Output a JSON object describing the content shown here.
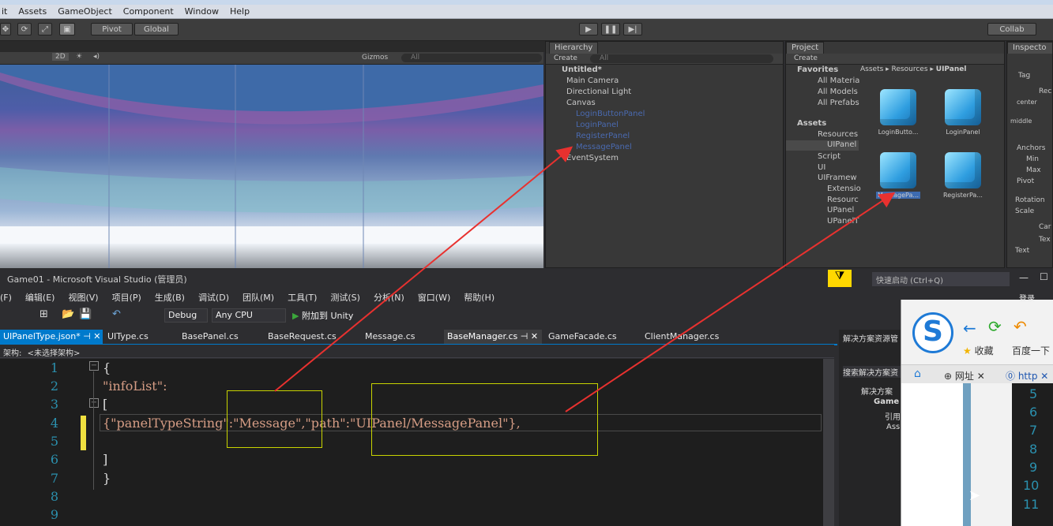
{
  "unity": {
    "menu": [
      "it",
      "Assets",
      "GameObject",
      "Component",
      "Window",
      "Help"
    ],
    "toolbar": {
      "pivot": "Pivot",
      "global": "Global",
      "collab": "Collab"
    },
    "scene": {
      "mode_2d": "2D",
      "gizmos": "Gizmos",
      "search_placeholder": "All"
    },
    "hierarchy": {
      "tab": "Hierarchy",
      "create": "Create",
      "search_placeholder": "All",
      "scene_name": "Untitled*",
      "items": [
        "Main Camera",
        "Directional Light",
        "Canvas",
        "LoginButtonPanel",
        "LoginPanel",
        "RegisterPanel",
        "MessagePanel",
        "EventSystem"
      ]
    },
    "project": {
      "tab": "Project",
      "create": "Create",
      "breadcrumb": [
        "Assets",
        "Resources",
        "UIPanel"
      ],
      "favorites_label": "Favorites",
      "favorites": [
        "All Materia",
        "All Models",
        "All Prefabs"
      ],
      "assets_label": "Assets",
      "tree": [
        "Resources",
        "UIPanel",
        "Script",
        "UI",
        "UIFramew",
        "Extensio",
        "Resourc",
        "UPanel",
        "UPanelT"
      ],
      "assets": [
        "LoginButto...",
        "LoginPanel",
        "MessagePa...",
        "RegisterPa..."
      ]
    },
    "inspector": {
      "tab": "Inspecto",
      "labels": [
        "Tag",
        "Rec",
        "center",
        "middle",
        "Anchors",
        "Min",
        "Max",
        "Pivot",
        "Rotation",
        "Scale",
        "Car",
        "Tex",
        "Text"
      ]
    }
  },
  "vs": {
    "title": "Game01 - Microsoft Visual Studio (管理员)",
    "quick_launch": "快速启动 (Ctrl+Q)",
    "login": "登录",
    "menu": [
      "(F)",
      "编辑(E)",
      "视图(V)",
      "项目(P)",
      "生成(B)",
      "调试(D)",
      "团队(M)",
      "工具(T)",
      "测试(S)",
      "分析(N)",
      "窗口(W)",
      "帮助(H)"
    ],
    "toolbar": {
      "config": "Debug",
      "platform": "Any CPU",
      "attach": "附加到 Unity"
    },
    "tabs": [
      "UIPanelType.json*",
      "UIType.cs",
      "BasePanel.cs",
      "BaseRequest.cs",
      "Message.cs",
      "BaseManager.cs",
      "GameFacade.cs",
      "ClientManager.cs"
    ],
    "nav": {
      "label": "架构:",
      "value": "<未选择架构>"
    },
    "line_numbers": [
      "1",
      "2",
      "3",
      "4",
      "5",
      "6",
      "7",
      "8",
      "9"
    ],
    "code": {
      "l1": "{",
      "l2": "\"infoList\":",
      "l3": "[",
      "l4a": "{\"panelTypeString\":\"Message\",\"path\":\"UIPanel/MessagePanel\"},",
      "l6": "]",
      "l7": "}"
    },
    "solution": {
      "header": "解决方案资源管",
      "search": "搜索解决方案资",
      "solution": "解决方案",
      "project": "Game",
      "refs": "引用",
      "assets": "Ass"
    }
  },
  "browser": {
    "favorites": "收藏",
    "baidu": "百度一下",
    "tab1": "网址",
    "tab2": "http",
    "line_numbers": [
      "5",
      "6",
      "7",
      "8",
      "9",
      "10",
      "11"
    ]
  },
  "colors": {
    "accent": "#007acc",
    "annotation_arrow": "#e8312f",
    "highlight_box": "#c8d400"
  }
}
